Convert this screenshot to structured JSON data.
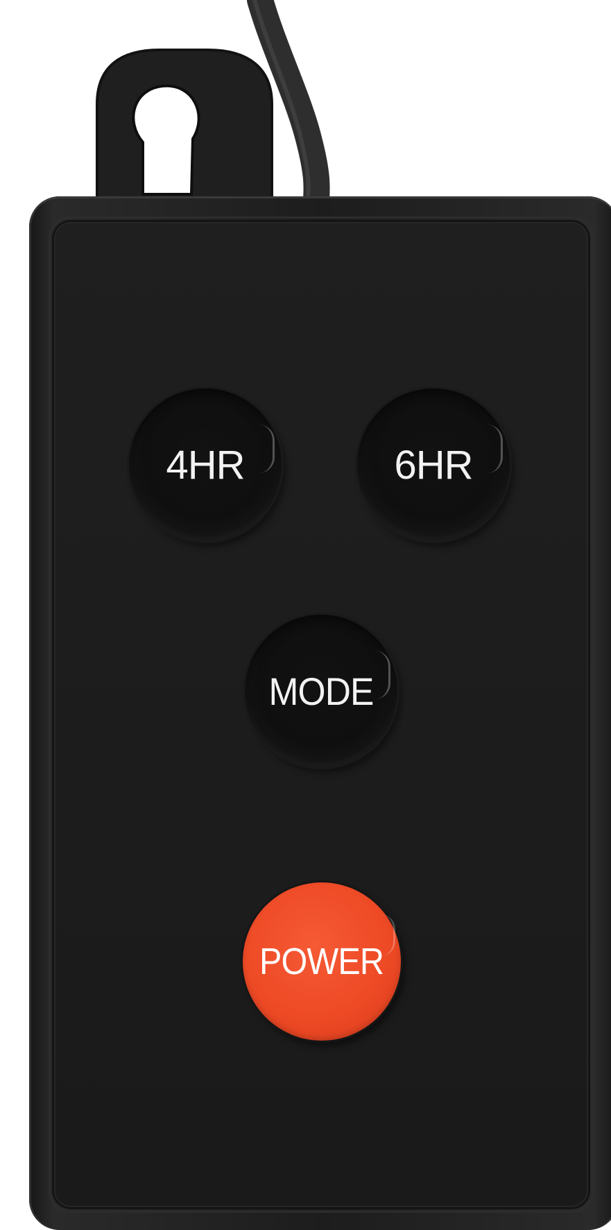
{
  "device": {
    "buttons": {
      "timer_4hr": "4HR",
      "timer_6hr": "6HR",
      "mode": "MODE",
      "power": "POWER"
    },
    "colors": {
      "body": "#1d1d1d",
      "power_button": "#ee4a26",
      "label_text": "#f2f2f2",
      "background": "#ffffff"
    }
  }
}
